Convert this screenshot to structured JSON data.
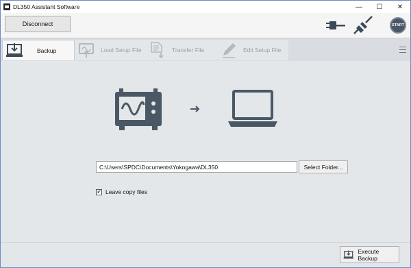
{
  "window": {
    "title": "DL350 Assistant Software",
    "controls": {
      "minimize": "—",
      "maximize": "☐",
      "close": "✕"
    }
  },
  "toolbar": {
    "disconnect_label": "Disconnect",
    "start_label": "START"
  },
  "tabs": [
    {
      "label": "Backup",
      "state": "active",
      "icon": "backup-icon"
    },
    {
      "label": "Load Setup File",
      "state": "disabled",
      "icon": "load-setup-icon"
    },
    {
      "label": "Transfer File",
      "state": "disabled",
      "icon": "transfer-file-icon"
    },
    {
      "label": "Edit Setup File",
      "state": "disabled",
      "icon": "edit-setup-icon"
    }
  ],
  "main": {
    "folder_path": "C:\\Users\\SPDC\\Documents\\Yokogawa\\DL350",
    "select_folder_label": "Select Folder...",
    "leave_copy_files_label": "Leave copy files",
    "leave_copy_files_checked": true
  },
  "footer": {
    "execute_label": "Execute Backup"
  },
  "colors": {
    "icon_dark": "#4a5866",
    "tab_bar": "#d9dde1",
    "panel_bg": "#e4e7ea"
  }
}
